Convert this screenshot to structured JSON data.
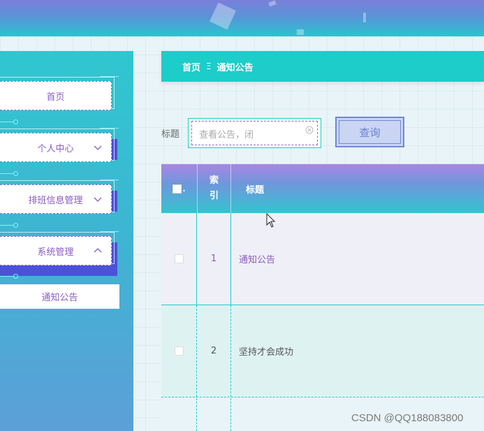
{
  "breadcrumb": {
    "home": "首页",
    "separator": "Ξ",
    "current": "通知公告"
  },
  "sidebar": {
    "items": [
      {
        "label": "首页",
        "has_chevron": false
      },
      {
        "label": "个人中心",
        "has_chevron": true,
        "chevron": "chevron-down-icon"
      },
      {
        "label": "排班信息管理",
        "has_chevron": true,
        "chevron": "chevron-down-icon"
      },
      {
        "label": "系统管理",
        "has_chevron": true,
        "chevron": "chevron-up-icon"
      }
    ],
    "sub_items": [
      {
        "label": "通知公告"
      }
    ]
  },
  "search": {
    "label": "标题",
    "value": "查看公告，闭",
    "query_button": "查询"
  },
  "table": {
    "headers": {
      "index": "索引",
      "title": "标题"
    },
    "rows": [
      {
        "index": "1",
        "title": "通知公告"
      },
      {
        "index": "2",
        "title": "坚持才会成功"
      }
    ]
  },
  "watermark": "CSDN @QQ188083800",
  "colors": {
    "accent": "#1ccdc9",
    "purple": "#8a5cc0",
    "header_gradient_top": "#a986e3"
  }
}
